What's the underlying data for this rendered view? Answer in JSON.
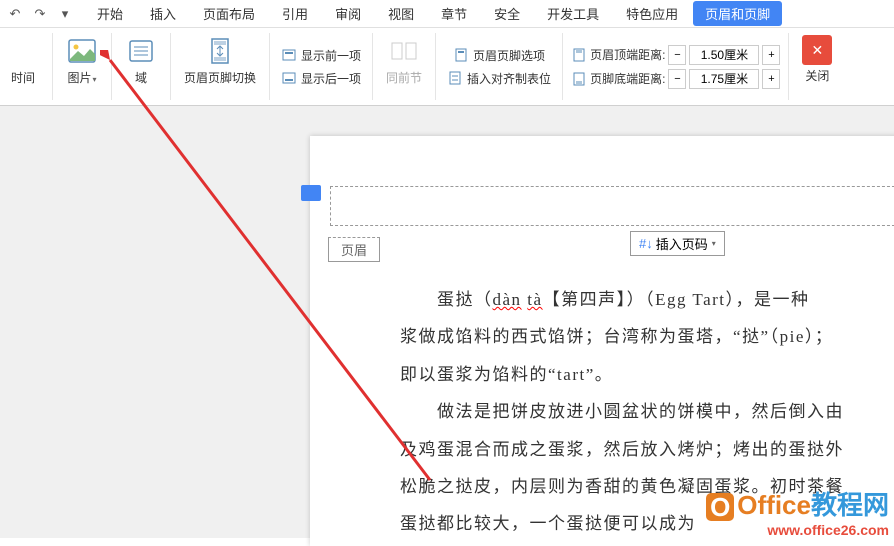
{
  "menubar": {
    "tabs": [
      "开始",
      "插入",
      "页面布局",
      "引用",
      "审阅",
      "视图",
      "章节",
      "安全",
      "开发工具",
      "特色应用",
      "页眉和页脚"
    ]
  },
  "ribbon": {
    "time_label": "时间",
    "picture_label": "图片",
    "field_label": "域",
    "header_footer_switch": "页眉页脚切换",
    "show_prev": "显示前一项",
    "show_next": "显示后一项",
    "same_prev": "同前节",
    "hf_options": "页眉页脚选项",
    "insert_align_tab": "插入对齐制表位",
    "header_top_dist": "页眉顶端距离:",
    "footer_bottom_dist": "页脚底端距离:",
    "header_dist_value": "1.50厘米",
    "footer_dist_value": "1.75厘米",
    "close_label": "关闭"
  },
  "document": {
    "header_tab": "页眉",
    "insert_page_number": "插入页码",
    "line1_a": "蛋挞（",
    "line1_dan": "dàn",
    "line1_sp": " ",
    "line1_ta": "tà",
    "line1_b": "【第四声】）（Egg Tart），是一种",
    "line2": "浆做成馅料的西式馅饼；台湾称为蛋塔，“挞”（pie）；",
    "line3": "即以蛋浆为馅料的“tart”。",
    "line4": "　　做法是把饼皮放进小圆盆状的饼模中，然后倒入由",
    "line5": "及鸡蛋混合而成之蛋浆，然后放入烤炉；烤出的蛋挞外",
    "line6": "松脆之挞皮，内层则为香甜的黄色凝固蛋浆。初时茶餐",
    "line7": "蛋挞都比较大，一个蛋挞便可以成为"
  },
  "watermark": {
    "brand_office": "Office",
    "brand_suffix": "教程网",
    "url": "www.office26.com"
  }
}
